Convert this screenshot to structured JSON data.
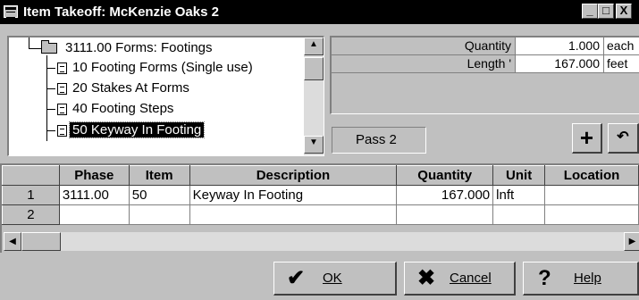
{
  "window": {
    "title": "Item Takeoff: McKenzie Oaks 2",
    "min_glyph": "_",
    "max_glyph": "□",
    "close_glyph": "X"
  },
  "tree": {
    "items": [
      {
        "label": "3111.00  Forms: Footings",
        "type": "folder"
      },
      {
        "label": "10  Footing Forms (Single use)",
        "type": "doc"
      },
      {
        "label": "20  Stakes At Forms",
        "type": "doc"
      },
      {
        "label": "40  Footing Steps",
        "type": "doc"
      },
      {
        "label": "50  Keyway In Footing",
        "type": "doc",
        "selected": true
      }
    ]
  },
  "fields": [
    {
      "label": "Quantity",
      "value": "1.000",
      "unit": "each"
    },
    {
      "label": "Length '",
      "value": "167.000",
      "unit": "feet"
    }
  ],
  "pass_label": "Pass 2",
  "grid": {
    "columns": [
      "Phase",
      "Item",
      "Description",
      "Quantity",
      "Unit",
      "Location"
    ],
    "rows": [
      {
        "num": "1",
        "phase": "3111.00",
        "item": "50",
        "description": "Keyway In Footing",
        "quantity": "167.000",
        "unit": "lnft",
        "location": ""
      },
      {
        "num": "2",
        "phase": "",
        "item": "",
        "description": "",
        "quantity": "",
        "unit": "",
        "location": ""
      }
    ]
  },
  "buttons": {
    "ok": "OK",
    "cancel": "Cancel",
    "help": "Help"
  }
}
